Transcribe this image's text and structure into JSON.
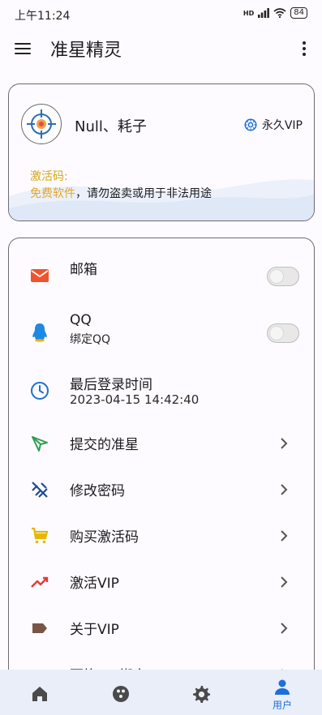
{
  "status_bar": {
    "time": "上午11:24",
    "network": "HD",
    "battery": "84"
  },
  "app_bar": {
    "title": "准星精灵"
  },
  "profile": {
    "username": "Null、耗子",
    "vip_label": "永久VIP",
    "activation_label": "激活码:",
    "notice_highlight": "免费软件",
    "notice_rest": "，请勿盗卖或用于非法用途"
  },
  "settings": {
    "email": {
      "title": "邮箱",
      "enabled": false
    },
    "qq": {
      "title": "QQ",
      "subtitle": "绑定QQ",
      "enabled": false
    },
    "last_login": {
      "title": "最后登录时间",
      "value": "2023-04-15 14:42:40"
    },
    "items": [
      {
        "label": "提交的准星",
        "icon": "send-icon",
        "color": "#2e9e4f"
      },
      {
        "label": "修改密码",
        "icon": "key-off-icon",
        "color": "#1e4b8f"
      },
      {
        "label": "购买激活码",
        "icon": "cart-icon",
        "color": "#e6b800"
      },
      {
        "label": "激活VIP",
        "icon": "trending-icon",
        "color": "#e53935"
      },
      {
        "label": "关于VIP",
        "icon": "label-icon",
        "color": "#795548"
      },
      {
        "label": "更换QQ绑定",
        "icon": "qq-swap-icon",
        "color": "#e53935"
      }
    ]
  },
  "colors": {
    "email_icon": "#f0542d",
    "qq_icon": "#1e88e5",
    "clock_icon": "#1e6fd9",
    "activation_label": "#d4a614",
    "nav_active": "#1e6fd9"
  },
  "bottom_nav": {
    "items": [
      {
        "name": "home",
        "icon": "home-icon"
      },
      {
        "name": "discover",
        "icon": "dots-circle-icon"
      },
      {
        "name": "settings",
        "icon": "gear-icon"
      },
      {
        "name": "user",
        "icon": "person-icon",
        "label": "用户",
        "active": true
      }
    ]
  }
}
